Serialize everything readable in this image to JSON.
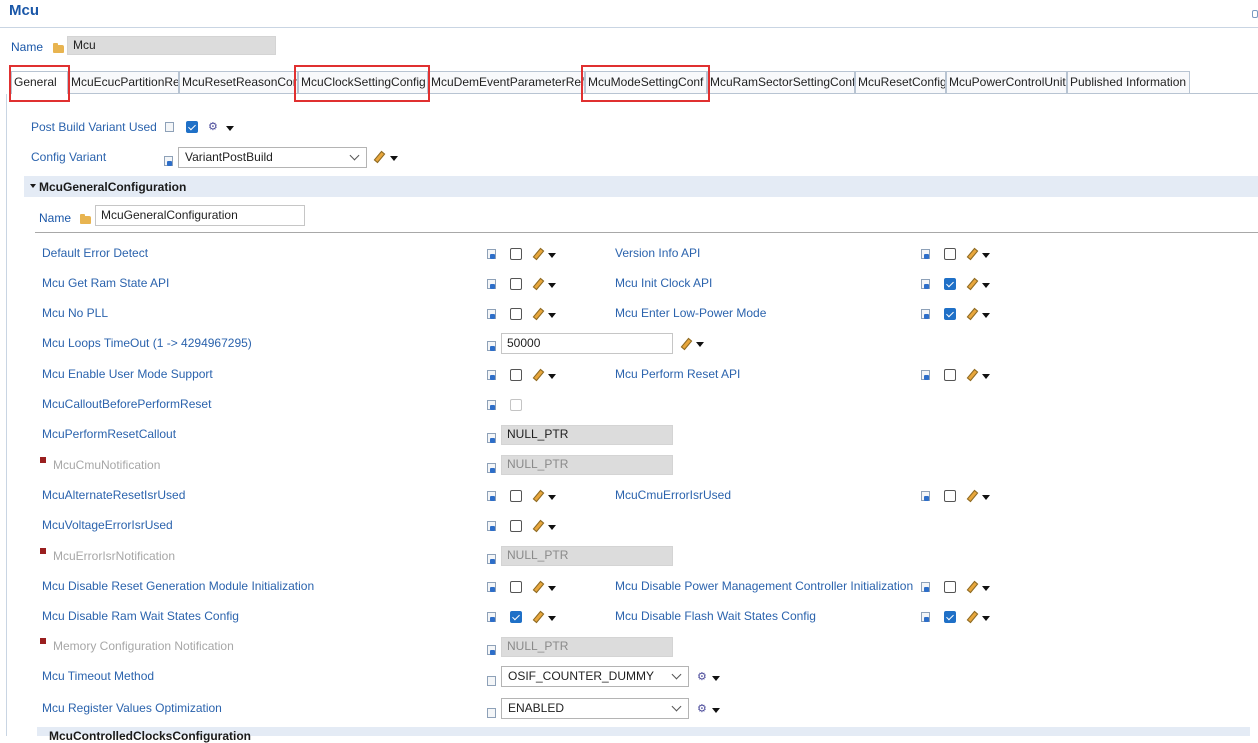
{
  "editor": {
    "title": "Mcu",
    "name_label": "Name",
    "name_value": "Mcu"
  },
  "tabs": [
    {
      "label": "General",
      "active": true,
      "highlighted": true
    },
    {
      "label": "McuEcucPartitionRef"
    },
    {
      "label": "McuResetReasonConf"
    },
    {
      "label": "McuClockSettingConfig",
      "highlighted": true
    },
    {
      "label": "McuDemEventParameterRefs"
    },
    {
      "label": "McuModeSettingConf",
      "highlighted": true
    },
    {
      "label": "McuRamSectorSettingConf"
    },
    {
      "label": "McuResetConfig"
    },
    {
      "label": "McuPowerControlUnit"
    },
    {
      "label": "Published Information"
    }
  ],
  "general": {
    "post_build_variant_used": {
      "label": "Post Build Variant Used",
      "checked": true
    },
    "config_variant": {
      "label": "Config Variant",
      "value": "VariantPostBuild"
    }
  },
  "section": {
    "title": "McuGeneralConfiguration",
    "name_label": "Name",
    "name_value": "McuGeneralConfiguration",
    "next_section_title": "McuControlledClocksConfiguration"
  },
  "params": {
    "default_error_detect": {
      "label": "Default Error Detect",
      "checked": false
    },
    "version_info_api": {
      "label": "Version Info API",
      "checked": false
    },
    "get_ram_state_api": {
      "label": "Mcu Get Ram State API",
      "checked": false
    },
    "init_clock_api": {
      "label": "Mcu Init Clock API",
      "checked": true
    },
    "no_pll": {
      "label": "Mcu No PLL",
      "checked": false
    },
    "enter_low_power": {
      "label": "Mcu Enter Low-Power Mode",
      "checked": true
    },
    "loops_timeout": {
      "label": "Mcu Loops TimeOut (1 -> 4294967295)",
      "value": "50000"
    },
    "enable_user_mode": {
      "label": "Mcu Enable User Mode Support",
      "checked": false
    },
    "perform_reset_api": {
      "label": "Mcu Perform Reset API",
      "checked": false
    },
    "callout_before_reset": {
      "label": "McuCalloutBeforePerformReset",
      "checked": false
    },
    "perform_reset_callout": {
      "label": "McuPerformResetCallout",
      "value": "NULL_PTR"
    },
    "cmu_notification": {
      "label": "McuCmuNotification",
      "value": "NULL_PTR"
    },
    "alternate_reset_isr": {
      "label": "McuAlternateResetIsrUsed",
      "checked": false
    },
    "cmu_error_isr": {
      "label": "McuCmuErrorIsrUsed",
      "checked": false
    },
    "voltage_error_isr": {
      "label": "McuVoltageErrorIsrUsed",
      "checked": false
    },
    "error_isr_notification": {
      "label": "McuErrorIsrNotification",
      "value": "NULL_PTR"
    },
    "disable_rgm_init": {
      "label": "Mcu Disable Reset Generation Module Initialization",
      "checked": false
    },
    "disable_pmc_init": {
      "label": "Mcu Disable Power Management Controller Initialization",
      "checked": false
    },
    "disable_ram_wait": {
      "label": "Mcu Disable Ram Wait States Config",
      "checked": true
    },
    "disable_flash_wait": {
      "label": "Mcu Disable Flash Wait States Config",
      "checked": true
    },
    "memory_config_notification": {
      "label": "Memory Configuration Notification",
      "value": "NULL_PTR"
    },
    "timeout_method": {
      "label": "Mcu Timeout Method",
      "value": "OSIF_COUNTER_DUMMY"
    },
    "register_values_opt": {
      "label": "Mcu Register Values Optimization",
      "value": "ENABLED"
    }
  },
  "colors": {
    "label_blue": "#2b63ad",
    "title_blue": "#1a57a8",
    "highlight_red": "#e03030",
    "checkbox_blue": "#1f70c7",
    "section_bg": "#e4ebf5"
  }
}
